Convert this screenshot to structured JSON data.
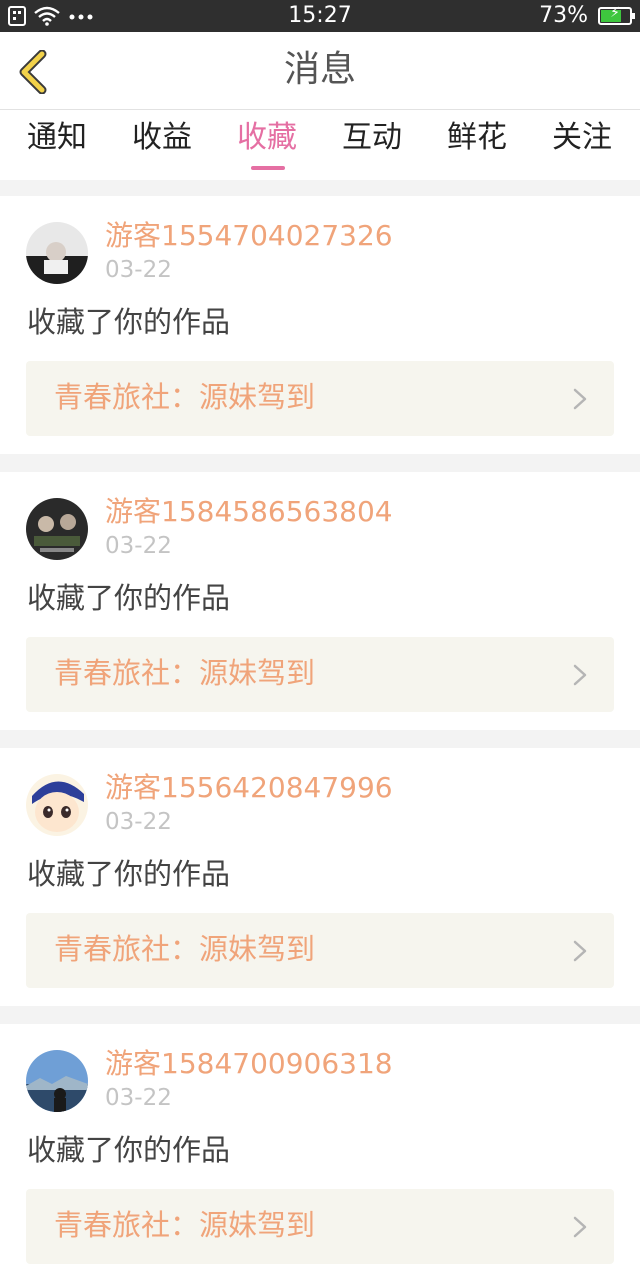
{
  "status_bar": {
    "time": "15:27",
    "battery": "73%",
    "battery_level": 0.73,
    "icons": [
      "sim-icon",
      "wifi-icon",
      "more-dots-icon",
      "battery-icon"
    ]
  },
  "header": {
    "title": "消息"
  },
  "tabs": [
    {
      "label": "通知",
      "active": false
    },
    {
      "label": "收益",
      "active": false
    },
    {
      "label": "收藏",
      "active": true
    },
    {
      "label": "互动",
      "active": false
    },
    {
      "label": "鲜花",
      "active": false
    },
    {
      "label": "关注",
      "active": false
    }
  ],
  "messages": [
    {
      "user": "游客1554704027326",
      "date": "03-22",
      "text": "收藏了你的作品",
      "work": "青春旅社：源妹驾到"
    },
    {
      "user": "游客1584586563804",
      "date": "03-22",
      "text": "收藏了你的作品",
      "work": "青春旅社：源妹驾到"
    },
    {
      "user": "游客1556420847996",
      "date": "03-22",
      "text": "收藏了你的作品",
      "work": "青春旅社：源妹驾到"
    },
    {
      "user": "游客1584700906318",
      "date": "03-22",
      "text": "收藏了你的作品",
      "work": "青春旅社：源妹驾到"
    }
  ],
  "colors": {
    "accent_pink": "#e56fa3",
    "orange_text": "#f0a47a",
    "back_arrow": "#f2d24a"
  }
}
